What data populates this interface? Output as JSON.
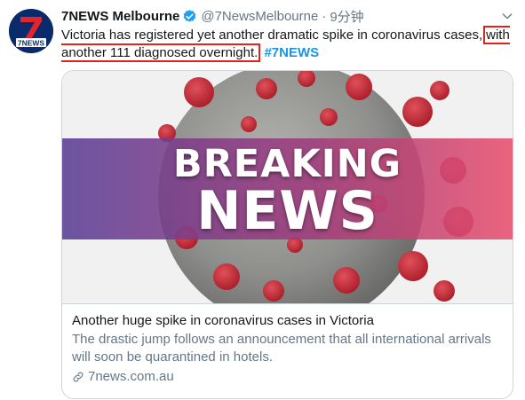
{
  "tweet": {
    "author_name": "7NEWS Melbourne",
    "handle": "@7NewsMelbourne",
    "separator": "·",
    "time": "9分钟",
    "text_before": "Victoria has registered yet another dramatic spike in coronavirus cases,",
    "text_highlight": "with another 111 diagnosed overnight.",
    "hashtag": "#7NEWS",
    "avatar_logo_text": "7NEWS"
  },
  "card": {
    "image_line1": "BREAKING",
    "image_line2": "NEWS",
    "title": "Another huge spike in coronavirus cases in Victoria",
    "description": "The drastic jump follows an announcement that all international arrivals will soon be quarantined in hotels.",
    "domain": "7news.com.au"
  },
  "colors": {
    "verified_blue": "#1da1f2",
    "link_blue": "#1b95e0",
    "highlight_box": "#e0241b",
    "banner_purple": "#5a3f96",
    "banner_pink": "#e8506e",
    "virus_red": "#c92a36",
    "virus_grey": "#8e8f8c"
  },
  "icons": {
    "verified": "verified-badge-icon",
    "menu": "chevron-down-icon",
    "link": "link-icon"
  }
}
